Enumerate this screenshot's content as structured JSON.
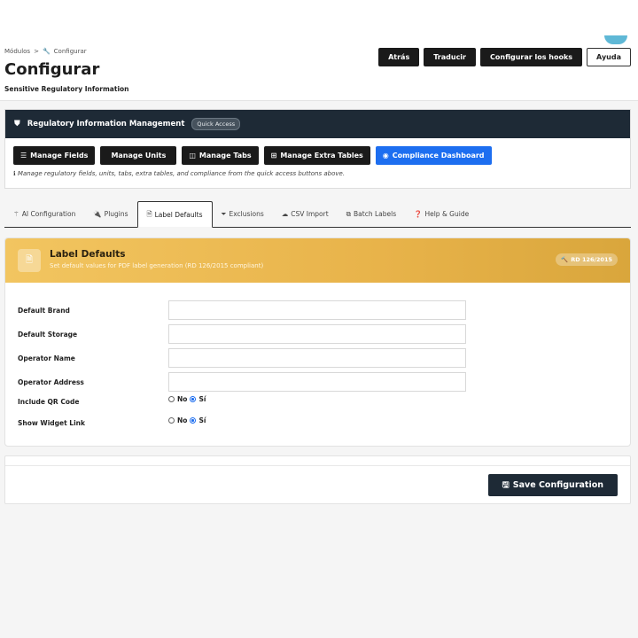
{
  "header": {
    "breadcrumb": {
      "root": "Módulos",
      "separator": ">",
      "current": "Configurar"
    },
    "title": "Configurar",
    "subtitle": "Sensitive Regulatory Information",
    "buttons": {
      "back": "Atrás",
      "translate": "Traducir",
      "hooks": "Configurar los hooks",
      "help": "Ayuda"
    }
  },
  "rim": {
    "title": "Regulatory Information Management",
    "badge": "Quick Access",
    "buttons": {
      "manage_fields": "Manage Fields",
      "manage_units": "Manage Units",
      "manage_tabs": "Manage Tabs",
      "manage_extra_tables": "Manage Extra Tables",
      "compliance_dashboard": "Compliance Dashboard"
    },
    "note": "Manage regulatory fields, units, tabs, extra tables, and compliance from the quick access buttons above."
  },
  "tabs": {
    "ai": "AI Configuration",
    "plugins": "Plugins",
    "label_defaults": "Label Defaults",
    "exclusions": "Exclusions",
    "csv_import": "CSV Import",
    "batch_labels": "Batch Labels",
    "help_guide": "Help & Guide"
  },
  "card": {
    "title": "Label Defaults",
    "subtitle": "Set default values for PDF label generation (RD 126/2015 compliant)",
    "badge": "RD 126/2015"
  },
  "form": {
    "default_brand": {
      "label": "Default Brand",
      "value": ""
    },
    "default_storage": {
      "label": "Default Storage",
      "value": ""
    },
    "operator_name": {
      "label": "Operator Name",
      "value": ""
    },
    "operator_address": {
      "label": "Operator Address",
      "value": ""
    },
    "include_qr": {
      "label": "Include QR Code",
      "no": "No",
      "yes": "Sí",
      "selected": "yes"
    },
    "show_widget": {
      "label": "Show Widget Link",
      "no": "No",
      "yes": "Sí",
      "selected": "yes"
    }
  },
  "footer": {
    "save": "Save Configuration"
  },
  "colors": {
    "primary_dark": "#1e2a36",
    "accent_blue": "#1d6ef0",
    "gold": "#e8b34a"
  }
}
